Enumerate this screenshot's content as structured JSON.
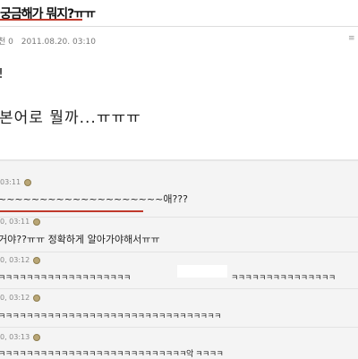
{
  "post": {
    "title": "궁금해가 뭐지?ㅠㅠ",
    "author_fragment": "천 0",
    "date": "2011.08.20. 03:10",
    "corner_icon": "menu-icon",
    "line1": "!",
    "line2": "본어로 뭘까...ㅠㅠㅠ"
  },
  "comments": [
    {
      "time": "03:11",
      "text": "~~~~~~~~~~~~~~~~~~~~애???"
    },
    {
      "time": "0, 03:11",
      "text": "거야??ㅠㅠ 정확하게 알아가야해서ㅠㅠ"
    },
    {
      "time": "0, 03:12",
      "text_left": "ㅋㅋㅋㅋㅋㅋㅋㅋㅋㅋㅋㅋㅋㅋㅋㅋㅋㅋㅋ",
      "text_right": "ㅋㅋㅋㅋㅋㅋㅋㅋㅋㅋㅋㅋㅋㅋㅋ"
    },
    {
      "time": "0, 03:12",
      "text": "ㅋㅋㅋㅋㅋㅋㅋㅋㅋㅋㅋㅋㅋㅋㅋㅋㅋㅋㅋㅋㅋㅋㅋㅋㅋㅋㅋㅋㅋㅋㅋㅋ"
    },
    {
      "time": "0, 03:13",
      "text": "ㅋㅋㅋㅋㅋㅋㅋㅋㅋㅋㅋㅋㅋㅋㅋㅋㅋㅋㅋㅋㅋㅋㅋㅋㅋㅋㅋ악 ㅋㅋㅋㅋ"
    }
  ],
  "colors": {
    "accent_red": "#c0392b",
    "background": "#f4f4f4"
  }
}
